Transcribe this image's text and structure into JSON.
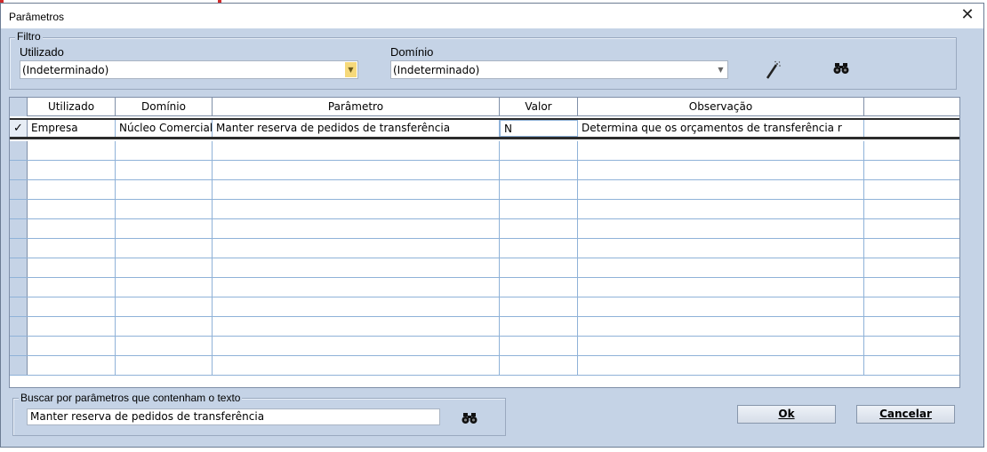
{
  "window": {
    "title": "Parâmetros",
    "close_glyph": "✕"
  },
  "filter": {
    "group_label": "Filtro",
    "utilizado_label": "Utilizado",
    "utilizado_value": "(Indeterminado)",
    "dominio_label": "Domínio",
    "dominio_value": "(Indeterminado)",
    "tools": [
      "magic-wand-icon",
      "binoculars-icon"
    ]
  },
  "grid": {
    "columns": [
      "Utilizado",
      "Domínio",
      "Parâmetro",
      "Valor",
      "Observação",
      ""
    ],
    "rows": [
      {
        "selected": true,
        "indicator": "✓",
        "utilizado": "Empresa",
        "dominio": "Núcleo Comercial",
        "parametro": "Manter reserva de pedidos de transferência",
        "valor": "N",
        "observacao": "Determina que os orçamentos de transferência r"
      }
    ],
    "empty_rows": 12
  },
  "search": {
    "group_label": "Buscar por parâmetros que contenham o texto",
    "value": "Manter reserva de pedidos de transferência"
  },
  "buttons": {
    "ok": "Ok",
    "cancel": "Cancelar"
  },
  "colors": {
    "window_bg": "#c5d3e6",
    "grid_line": "#8fb2d8",
    "accent_arrow": "#f6d97a"
  }
}
